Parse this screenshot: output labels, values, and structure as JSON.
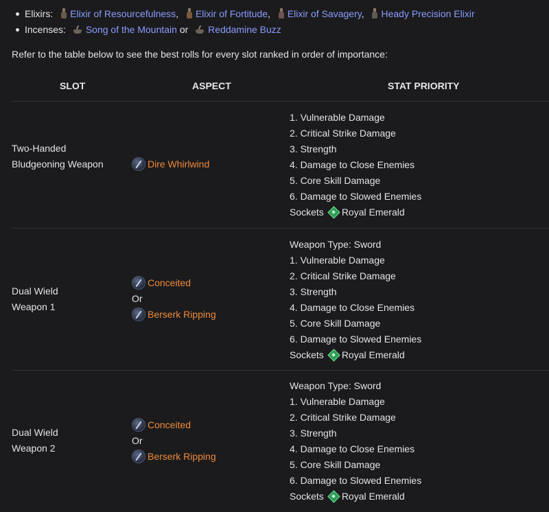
{
  "consumables": {
    "elixirs_label": "Elixirs:",
    "elixirs": [
      {
        "name": "Elixir of Resourcefulness",
        "icon": "elixir-icon"
      },
      {
        "name": "Elixir of Fortitude",
        "icon": "elixir-icon"
      },
      {
        "name": "Elixir of Savagery",
        "icon": "elixir-icon"
      },
      {
        "name": "Heady Precision Elixir",
        "icon": "elixir-icon"
      }
    ],
    "comma": ",",
    "incenses_label": "Incenses:",
    "incenses": [
      {
        "name": "Song of the Mountain",
        "icon": "incense-icon"
      },
      {
        "name": "Reddamine Buzz",
        "icon": "incense-icon"
      }
    ],
    "or_word": "or"
  },
  "intro": "Refer to the table below to see the best rolls for every slot ranked in order of importance:",
  "table": {
    "headers": {
      "slot": "SLOT",
      "aspect": "ASPECT",
      "priority": "STAT PRIORITY"
    },
    "or_word": "Or",
    "rows": [
      {
        "slot_line1": "Two-Handed",
        "slot_line2": "Bludgeoning Weapon",
        "aspects": [
          "Dire Whirlwind"
        ],
        "weapon_type": "",
        "stats": [
          "1. Vulnerable Damage",
          "2. Critical Strike Damage",
          "3. Strength",
          "4. Damage to Close Enemies",
          "5. Core Skill Damage",
          "6. Damage to Slowed Enemies"
        ],
        "sockets_label": "Sockets",
        "socket_gem": "Royal Emerald"
      },
      {
        "slot_line1": "Dual Wield",
        "slot_line2": "Weapon 1",
        "aspects": [
          "Conceited",
          "Berserk Ripping"
        ],
        "weapon_type": "Weapon Type: Sword",
        "stats": [
          "1. Vulnerable Damage",
          "2. Critical Strike Damage",
          "3. Strength",
          "4. Damage to Close Enemies",
          "5. Core Skill Damage",
          "6. Damage to Slowed Enemies"
        ],
        "sockets_label": "Sockets",
        "socket_gem": "Royal Emerald"
      },
      {
        "slot_line1": "Dual Wield",
        "slot_line2": "Weapon 2",
        "aspects": [
          "Conceited",
          "Berserk Ripping"
        ],
        "weapon_type": "Weapon Type: Sword",
        "stats": [
          "1. Vulnerable Damage",
          "2. Critical Strike Damage",
          "3. Strength",
          "4. Damage to Close Enemies",
          "5. Core Skill Damage",
          "6. Damage to Slowed Enemies"
        ],
        "sockets_label": "Sockets",
        "socket_gem": "Royal Emerald"
      }
    ]
  },
  "colors": {
    "background": "#1b1b1d",
    "link": "#8a9cff",
    "aspect": "#f08a3a",
    "text": "#e4e4e6",
    "divider": "#343438"
  }
}
